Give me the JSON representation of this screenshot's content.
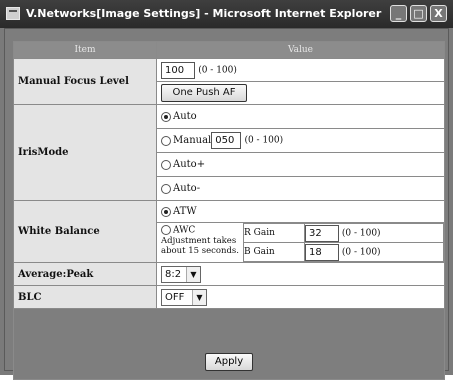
{
  "window": {
    "title": "V.Networks[Image Settings] - Microsoft Internet Explorer",
    "minimize": "_",
    "maximize": "□",
    "close": "X"
  },
  "table": {
    "col_item": "Item",
    "col_value": "Value"
  },
  "manual_focus": {
    "label": "Manual Focus Level",
    "value": "100",
    "range": "(0 - 100)",
    "one_push_af": "One Push AF"
  },
  "iris": {
    "label": "IrisMode",
    "auto": "Auto",
    "manual": "Manual",
    "manual_value": "050",
    "manual_range": "(0 - 100)",
    "auto_plus": "Auto+",
    "auto_minus": "Auto-",
    "selected": "Auto"
  },
  "white_balance": {
    "label": "White Balance",
    "atw": "ATW",
    "awc": "AWC",
    "awc_note_1": "Adjustment takes",
    "awc_note_2": "about 15 seconds.",
    "r_gain_label": "R Gain",
    "r_gain_value": "32",
    "r_gain_range": "(0 - 100)",
    "b_gain_label": "B Gain",
    "b_gain_value": "18",
    "b_gain_range": "(0 - 100)",
    "selected": "ATW"
  },
  "average_peak": {
    "label": "Average:Peak",
    "value": "8:2"
  },
  "blc": {
    "label": "BLC",
    "value": "OFF"
  },
  "apply": "Apply"
}
